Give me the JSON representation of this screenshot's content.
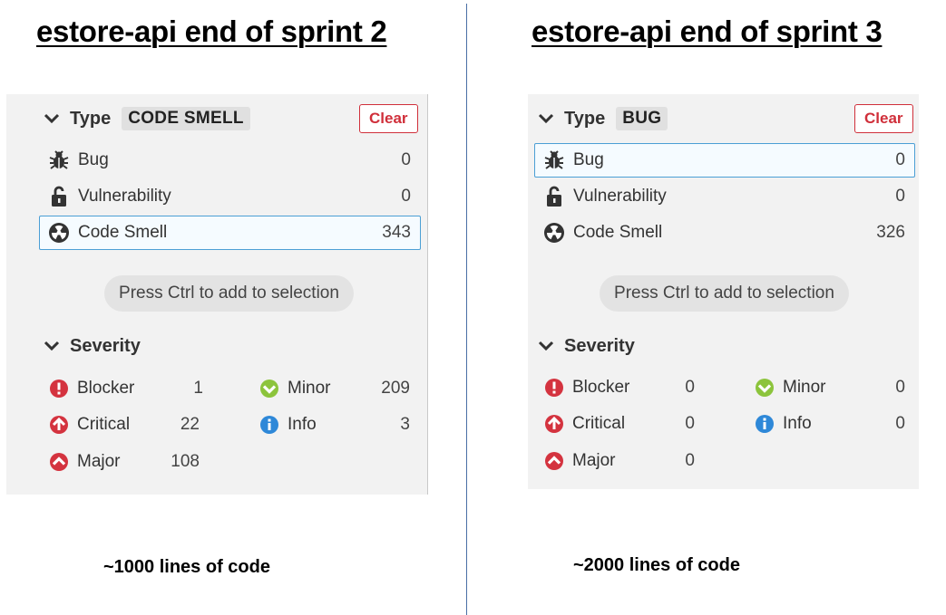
{
  "left": {
    "title": "estore-api end of sprint 2",
    "caption": "~1000 lines of code",
    "type_header": "Type",
    "type_tag": "CODE SMELL",
    "clear_label": "Clear",
    "types": [
      {
        "label": "Bug",
        "count": "0",
        "icon": "bug-icon"
      },
      {
        "label": "Vulnerability",
        "count": "0",
        "icon": "lock-icon"
      },
      {
        "label": "Code Smell",
        "count": "343",
        "icon": "code-smell-icon"
      }
    ],
    "hint": "Press Ctrl to add to selection",
    "severity_header": "Severity",
    "severities": {
      "blocker": {
        "label": "Blocker",
        "count": "1"
      },
      "critical": {
        "label": "Critical",
        "count": "22"
      },
      "major": {
        "label": "Major",
        "count": "108"
      },
      "minor": {
        "label": "Minor",
        "count": "209"
      },
      "info": {
        "label": "Info",
        "count": "3"
      }
    }
  },
  "right": {
    "title": "estore-api end of sprint 3",
    "caption": "~2000 lines of code",
    "type_header": "Type",
    "type_tag": "BUG",
    "clear_label": "Clear",
    "types": [
      {
        "label": "Bug",
        "count": "0",
        "icon": "bug-icon"
      },
      {
        "label": "Vulnerability",
        "count": "0",
        "icon": "lock-icon"
      },
      {
        "label": "Code Smell",
        "count": "326",
        "icon": "code-smell-icon"
      }
    ],
    "hint": "Press Ctrl to add to selection",
    "severity_header": "Severity",
    "severities": {
      "blocker": {
        "label": "Blocker",
        "count": "0"
      },
      "critical": {
        "label": "Critical",
        "count": "0"
      },
      "major": {
        "label": "Major",
        "count": "0"
      },
      "minor": {
        "label": "Minor",
        "count": "0"
      },
      "info": {
        "label": "Info",
        "count": "0"
      }
    }
  },
  "colors": {
    "clear_border": "#d02f3a",
    "selected_border": "#4b9fd5",
    "blocker": "#d4333f",
    "critical": "#d4333f",
    "major": "#d4333f",
    "minor": "#8cc43c",
    "info": "#2e88d8",
    "divider": "#4a6fa5"
  }
}
